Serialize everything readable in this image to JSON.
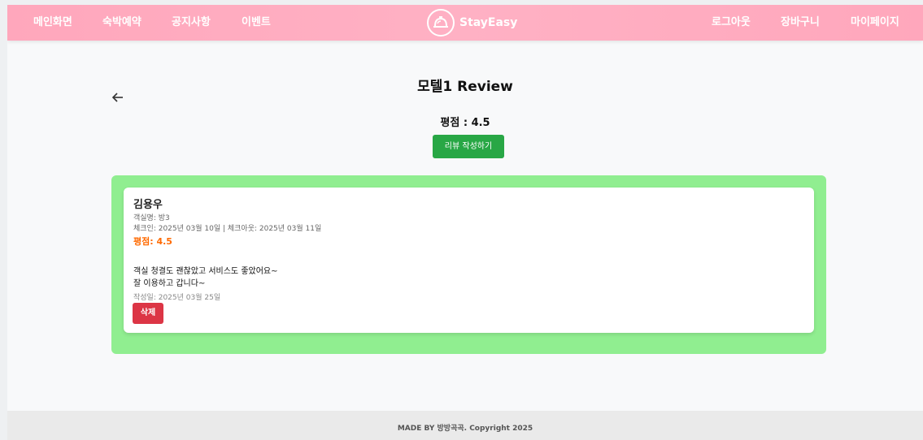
{
  "nav": {
    "left_links": [
      "메인화면",
      "숙박예약",
      "공지사항",
      "이벤트"
    ],
    "brand": "StayEasy",
    "brand_icon": "hotel-bell-icon",
    "right_links": [
      "로그아웃",
      "장바구니",
      "마이페이지"
    ]
  },
  "page": {
    "back_icon": "arrow-left-icon",
    "title": "모텔1 Review",
    "rating_label": "평점",
    "rating_sep": " : ",
    "rating_value": "4.5",
    "write_button": "리뷰 작성하기"
  },
  "reviews": [
    {
      "author": "김용우",
      "room": "객실명: 방3",
      "dates": "체크인: 2025년 03월 10일 | 체크아웃: 2025년 03월 11일",
      "rating": "평점: 4.5",
      "content_lines": [
        "객실 청결도 괜찮았고 서비스도 좋았어요~",
        "잘 이용하고 갑니다~"
      ],
      "written": "작성일: 2025년 03월 25일",
      "delete_label": "삭제"
    }
  ],
  "footer": "MADE BY 방방곡곡. Copyright 2025",
  "colors": {
    "nav": "#ffa7bc",
    "panel": "#90ee90",
    "write_button": "#28a745",
    "delete_button": "#dc3545",
    "rating_accent": "#ff6a00"
  }
}
